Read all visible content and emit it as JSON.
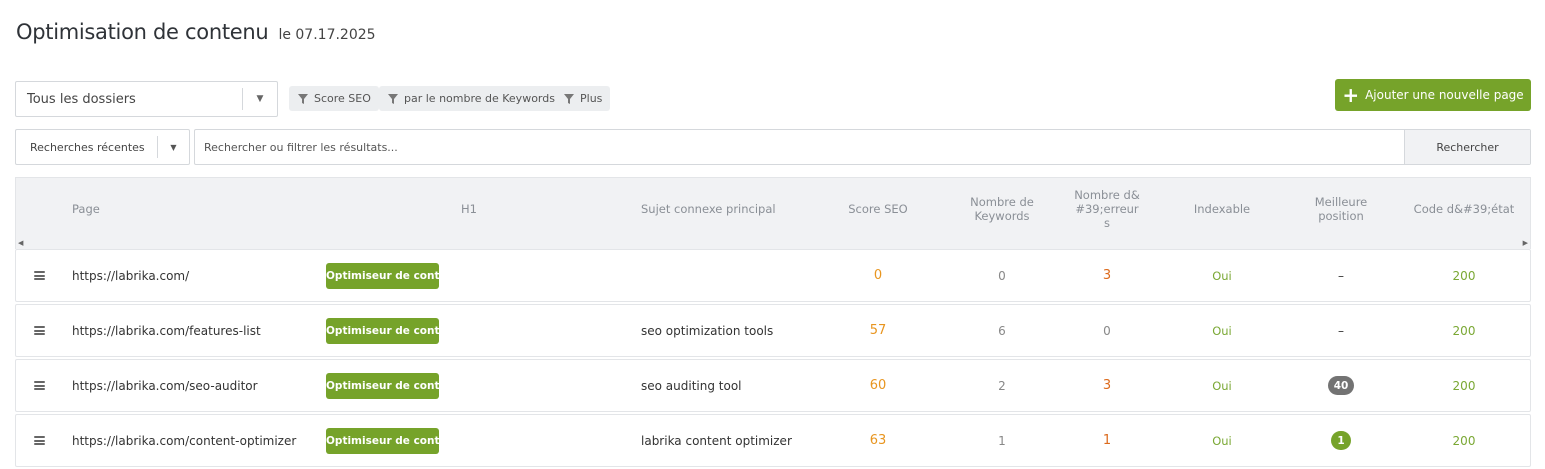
{
  "header": {
    "title": "Optimisation de contenu",
    "date": "le 07.17.2025"
  },
  "toolbar": {
    "folder_select": "Tous les dossiers",
    "filters": [
      {
        "label": "Score SEO",
        "icon": "filter-icon"
      },
      {
        "label": "par le nombre de Keywords",
        "icon": "filter-icon"
      },
      {
        "label": "Plus",
        "icon": "filter-icon"
      }
    ],
    "add_button": "Ajouter une nouvelle page",
    "recent_searches": "Recherches récentes",
    "search_placeholder": "Rechercher ou filtrer les résultats...",
    "search_button": "Rechercher"
  },
  "table": {
    "columns": {
      "page": "Page",
      "h1": "H1",
      "topic": "Sujet connexe principal",
      "seo": "Score SEO",
      "keywords": "Nombre de Keywords",
      "errors": "Nombre d&#39;erreur s",
      "indexable": "Indexable",
      "position": "Meilleure position",
      "status": "Code d&#39;état"
    },
    "rows": [
      {
        "url": "https://labrika.com/",
        "h1": "Optimiseur de contenu",
        "topic": "",
        "seo": "0",
        "keywords": "0",
        "errors": "3",
        "indexable": "Oui",
        "position": "–",
        "status": "200"
      },
      {
        "url": "https://labrika.com/features-list",
        "h1": "Optimiseur de contenu",
        "topic": "seo optimization tools",
        "seo": "57",
        "keywords": "6",
        "errors": "0",
        "indexable": "Oui",
        "position": "–",
        "status": "200"
      },
      {
        "url": "https://labrika.com/seo-auditor",
        "h1": "Optimiseur de contenu",
        "topic": "seo auditing tool",
        "seo": "60",
        "keywords": "2",
        "errors": "3",
        "indexable": "Oui",
        "position": "40",
        "status": "200"
      },
      {
        "url": "https://labrika.com/content-optimizer",
        "h1": "Optimiseur de contenu",
        "topic": "labrika content optimizer",
        "seo": "63",
        "keywords": "1",
        "errors": "1",
        "indexable": "Oui",
        "position": "1",
        "status": "200"
      }
    ]
  },
  "colors": {
    "accent": "#76a32a",
    "score": "#e8951f",
    "errors": "#dc6a1c",
    "ok": "#7aa834"
  }
}
